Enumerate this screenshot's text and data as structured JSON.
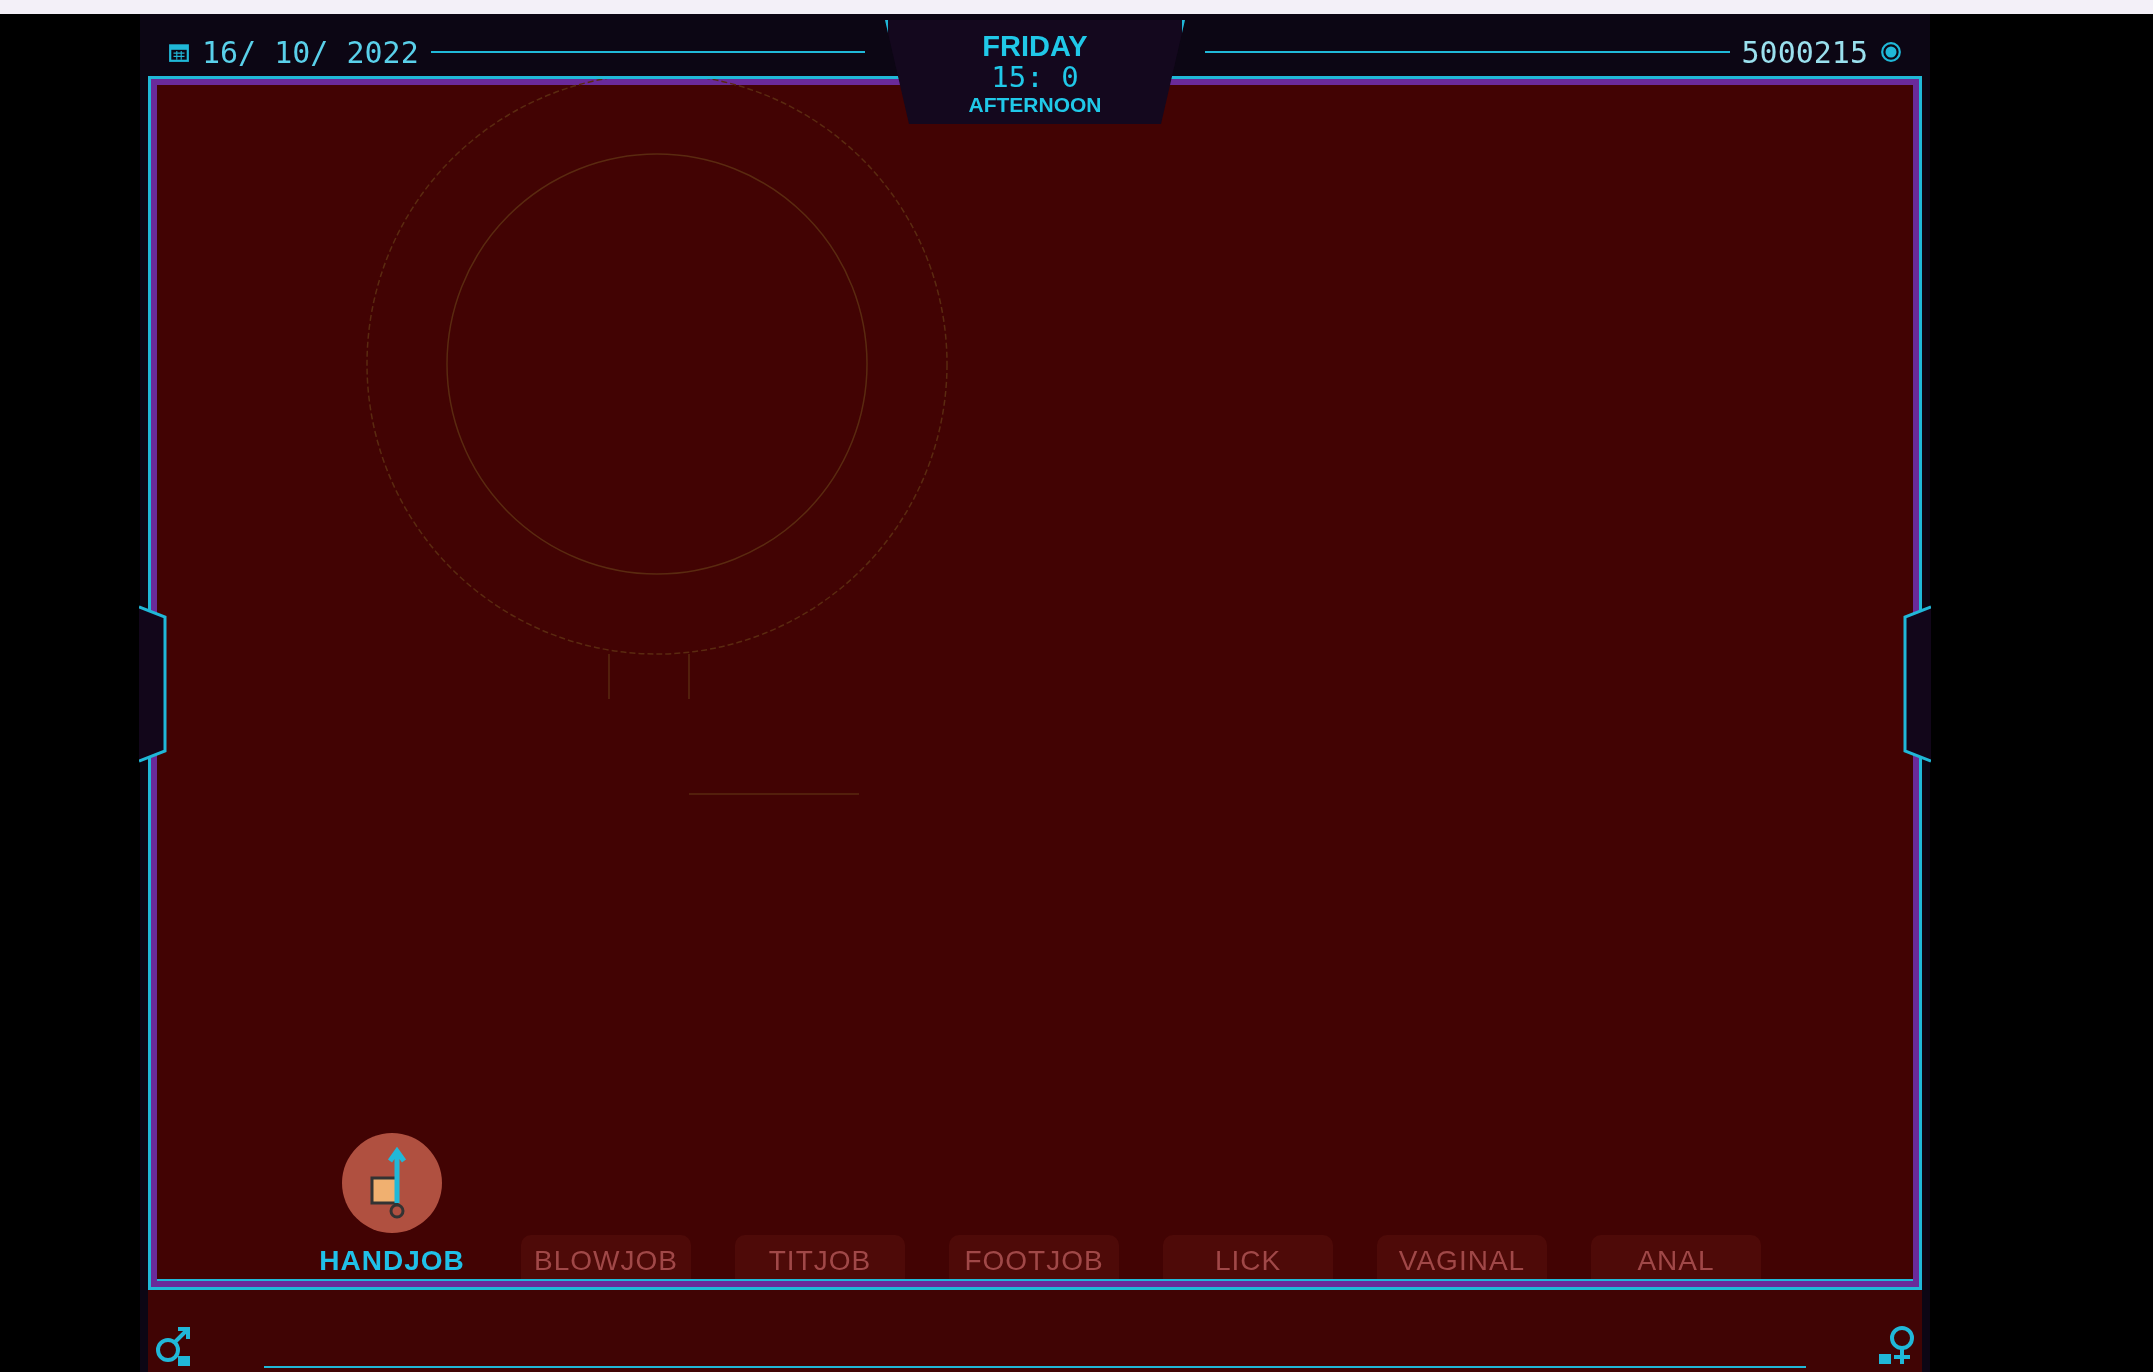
{
  "header": {
    "date": "16/ 10/ 2022",
    "day": "FRIDAY",
    "time": "15: 0",
    "period": "AFTERNOON",
    "money": "5000215"
  },
  "tabs": [
    {
      "label": "HANDJOB",
      "selected": true
    },
    {
      "label": "BLOWJOB",
      "selected": false
    },
    {
      "label": "TITJOB",
      "selected": false
    },
    {
      "label": "FOOTJOB",
      "selected": false
    },
    {
      "label": "LICK",
      "selected": false
    },
    {
      "label": "VAGINAL",
      "selected": false
    },
    {
      "label": "ANAL",
      "selected": false
    }
  ]
}
